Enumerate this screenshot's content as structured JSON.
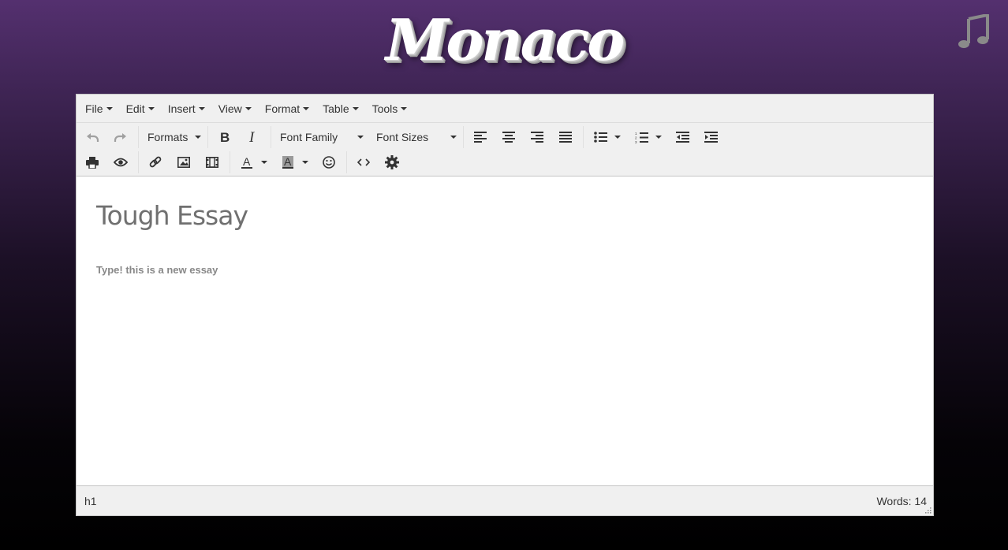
{
  "brand": {
    "logo_text": "Monaco"
  },
  "icons": {
    "music": "music-note-icon"
  },
  "menubar": {
    "items": [
      "File",
      "Edit",
      "Insert",
      "View",
      "Format",
      "Table",
      "Tools"
    ]
  },
  "toolbar": {
    "formats_label": "Formats",
    "font_family_label": "Font Family",
    "font_sizes_label": "Font Sizes"
  },
  "document": {
    "title": "Tough Essay",
    "paragraph": "Type! this is a new essay"
  },
  "statusbar": {
    "path": "h1",
    "word_count": "Words: 14"
  },
  "colors": {
    "background_top": "#54306f",
    "background_bottom": "#000000",
    "chrome": "#f0f0f0",
    "icon": "#333333",
    "icon_disabled": "#a0a0a0"
  }
}
